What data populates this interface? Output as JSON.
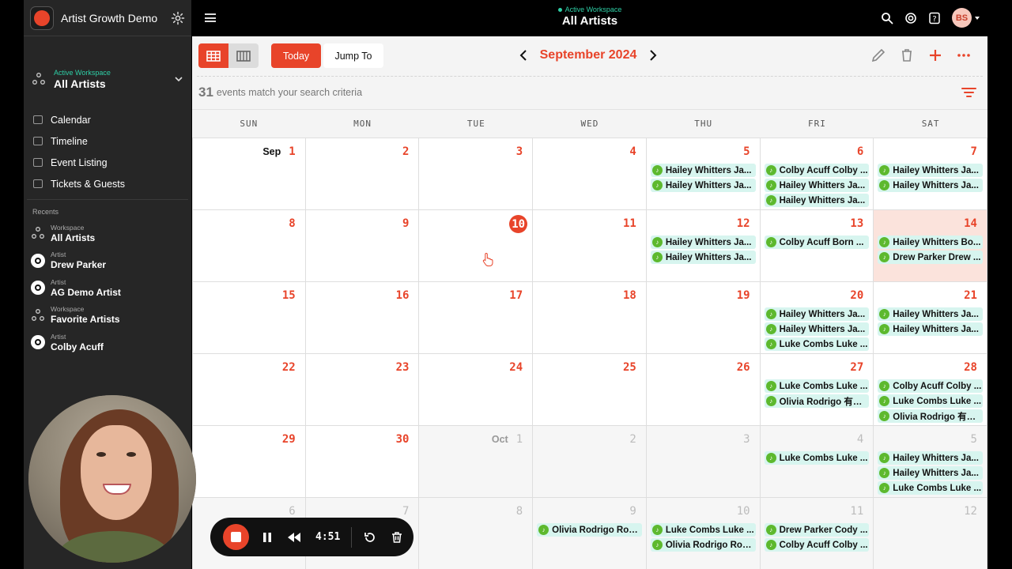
{
  "app": {
    "name": "Artist Growth Demo"
  },
  "topbar": {
    "workspace_label": "Active Workspace",
    "workspace_name": "All Artists",
    "avatar_initials": "BS"
  },
  "sidebar": {
    "workspace_label": "Active Workspace",
    "workspace_name": "All Artists",
    "nav": [
      {
        "label": "Calendar",
        "icon": "calendar-icon"
      },
      {
        "label": "Timeline",
        "icon": "timeline-icon"
      },
      {
        "label": "Event Listing",
        "icon": "list-icon"
      },
      {
        "label": "Tickets & Guests",
        "icon": "ticket-icon"
      }
    ],
    "recents_title": "Recents",
    "recents": [
      {
        "type": "Workspace",
        "name": "All Artists",
        "icon": "workspace-icon"
      },
      {
        "type": "Artist",
        "name": "Drew Parker",
        "icon": "artist-icon"
      },
      {
        "type": "Artist",
        "name": "AG Demo Artist",
        "icon": "artist-icon"
      },
      {
        "type": "Workspace",
        "name": "Favorite Artists",
        "icon": "workspace-icon"
      },
      {
        "type": "Artist",
        "name": "Colby Acuff",
        "icon": "artist-icon"
      }
    ]
  },
  "toolbar": {
    "today_label": "Today",
    "jump_label": "Jump To",
    "month_title": "September 2024"
  },
  "results": {
    "count": "31",
    "text": "events match your search criteria"
  },
  "calendar": {
    "days_of_week": [
      "SUN",
      "MON",
      "TUE",
      "WED",
      "THU",
      "FRI",
      "SAT"
    ],
    "weeks": [
      [
        {
          "day": "1",
          "month_label": "Sep",
          "events": []
        },
        {
          "day": "2",
          "events": []
        },
        {
          "day": "3",
          "events": []
        },
        {
          "day": "4",
          "events": []
        },
        {
          "day": "5",
          "events": [
            "Hailey Whitters Ja...",
            "Hailey Whitters Ja..."
          ]
        },
        {
          "day": "6",
          "events": [
            "Colby Acuff Colby ...",
            "Hailey Whitters Ja...",
            "Hailey Whitters Ja..."
          ]
        },
        {
          "day": "7",
          "events": [
            "Hailey Whitters Ja...",
            "Hailey Whitters Ja..."
          ]
        }
      ],
      [
        {
          "day": "8",
          "events": []
        },
        {
          "day": "9",
          "events": []
        },
        {
          "day": "10",
          "today": true,
          "events": []
        },
        {
          "day": "11",
          "events": []
        },
        {
          "day": "12",
          "events": [
            "Hailey Whitters Ja...",
            "Hailey Whitters Ja..."
          ]
        },
        {
          "day": "13",
          "events": [
            "Colby Acuff Born ..."
          ]
        },
        {
          "day": "14",
          "highlight": true,
          "events": [
            "Hailey Whitters Bo...",
            "Drew Parker Drew ..."
          ]
        }
      ],
      [
        {
          "day": "15",
          "events": []
        },
        {
          "day": "16",
          "events": []
        },
        {
          "day": "17",
          "events": []
        },
        {
          "day": "18",
          "events": []
        },
        {
          "day": "19",
          "events": []
        },
        {
          "day": "20",
          "events": [
            "Hailey Whitters Ja...",
            "Hailey Whitters Ja...",
            "Luke Combs Luke ..."
          ]
        },
        {
          "day": "21",
          "events": [
            "Hailey Whitters Ja...",
            "Hailey Whitters Ja..."
          ]
        }
      ],
      [
        {
          "day": "22",
          "events": []
        },
        {
          "day": "23",
          "events": []
        },
        {
          "day": "24",
          "events": []
        },
        {
          "day": "25",
          "events": []
        },
        {
          "day": "26",
          "events": []
        },
        {
          "day": "27",
          "events": [
            "Luke Combs Luke ...",
            "Olivia Rodrigo 有明..."
          ]
        },
        {
          "day": "28",
          "events": [
            "Colby Acuff Colby ...",
            "Luke Combs Luke ...",
            "Olivia Rodrigo 有明..."
          ]
        }
      ],
      [
        {
          "day": "29",
          "events": []
        },
        {
          "day": "30",
          "events": []
        },
        {
          "day": "1",
          "month_label": "Oct",
          "other": true,
          "events": []
        },
        {
          "day": "2",
          "other": true,
          "events": []
        },
        {
          "day": "3",
          "other": true,
          "events": []
        },
        {
          "day": "4",
          "other": true,
          "events": [
            "Luke Combs Luke ..."
          ]
        },
        {
          "day": "5",
          "other": true,
          "events": [
            "Hailey Whitters Ja...",
            "Hailey Whitters Ja...",
            "Luke Combs Luke ..."
          ]
        }
      ],
      [
        {
          "day": "6",
          "other": true,
          "events": []
        },
        {
          "day": "7",
          "other": true,
          "events": []
        },
        {
          "day": "8",
          "other": true,
          "events": []
        },
        {
          "day": "9",
          "other": true,
          "events": [
            "Olivia Rodrigo Rod ..."
          ]
        },
        {
          "day": "10",
          "other": true,
          "events": [
            "Luke Combs Luke ...",
            "Olivia Rodrigo Rod ..."
          ]
        },
        {
          "day": "11",
          "other": true,
          "events": [
            "Drew Parker Cody ...",
            "Colby Acuff Colby ..."
          ]
        },
        {
          "day": "12",
          "other": true,
          "events": []
        }
      ]
    ]
  },
  "recorder": {
    "time": "4:51"
  },
  "colors": {
    "accent": "#e8442a",
    "workspace_label": "#2ecfa6",
    "event_bg": "#d7f5ef",
    "event_dot": "#5db92e"
  }
}
